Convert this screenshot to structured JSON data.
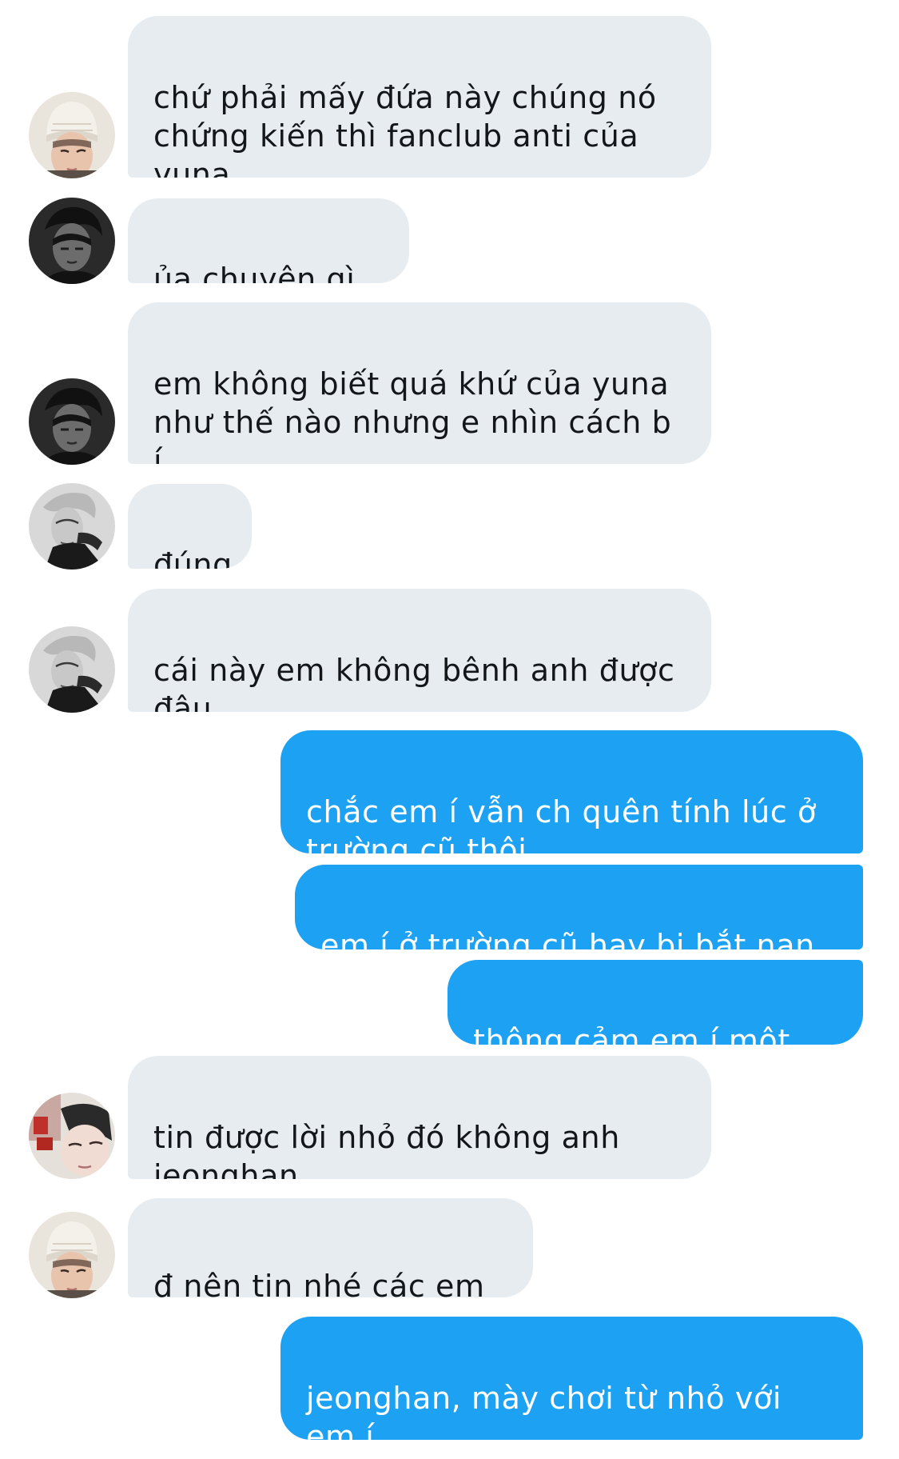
{
  "messages": [
    {
      "side": "in",
      "avatar": "white-beanie-avatar",
      "text": "chứ phải mấy đứa này chúng nó\nchứng kiến thì fanclub anti của yuna\nđông phải biết"
    },
    {
      "side": "in",
      "avatar": "dark-portrait-avatar",
      "text": "ủa chuyện gì hả"
    },
    {
      "side": "in",
      "avatar": "dark-portrait-avatar",
      "text": "em không biết quá khứ của yuna\nnhư thế nào nhưng e nhìn cách b í\ncư xử thì..."
    },
    {
      "side": "in",
      "avatar": "grayscale-portrait-avatar",
      "text": "đúng"
    },
    {
      "side": "in",
      "avatar": "grayscale-portrait-avatar",
      "text": "cái này em không bênh anh được\nđâu"
    },
    {
      "side": "out",
      "text": "chắc em í vẫn ch quên tính lúc ở\ntrường cũ thôi"
    },
    {
      "side": "out",
      "text": "em í ở trường cũ hay bị bắt nạn mà"
    },
    {
      "side": "out",
      "text": "thông cảm em í một chút"
    },
    {
      "side": "in",
      "avatar": "selfie-avatar",
      "text": "tin được lời nhỏ đó không anh\njeonghan"
    },
    {
      "side": "in",
      "avatar": "white-beanie-avatar",
      "text": "đ nên tin nhé các em",
      "emoji": "clown-face-icon"
    },
    {
      "side": "out",
      "text": "jeonghan, mày chơi từ nhỏ với em í\nnên biết mà đúng không"
    }
  ],
  "colors": {
    "incoming_bubble": "#e6ecf0",
    "incoming_text": "#14171a",
    "outgoing_bubble": "#1da1f2",
    "outgoing_text": "#ffffff"
  }
}
